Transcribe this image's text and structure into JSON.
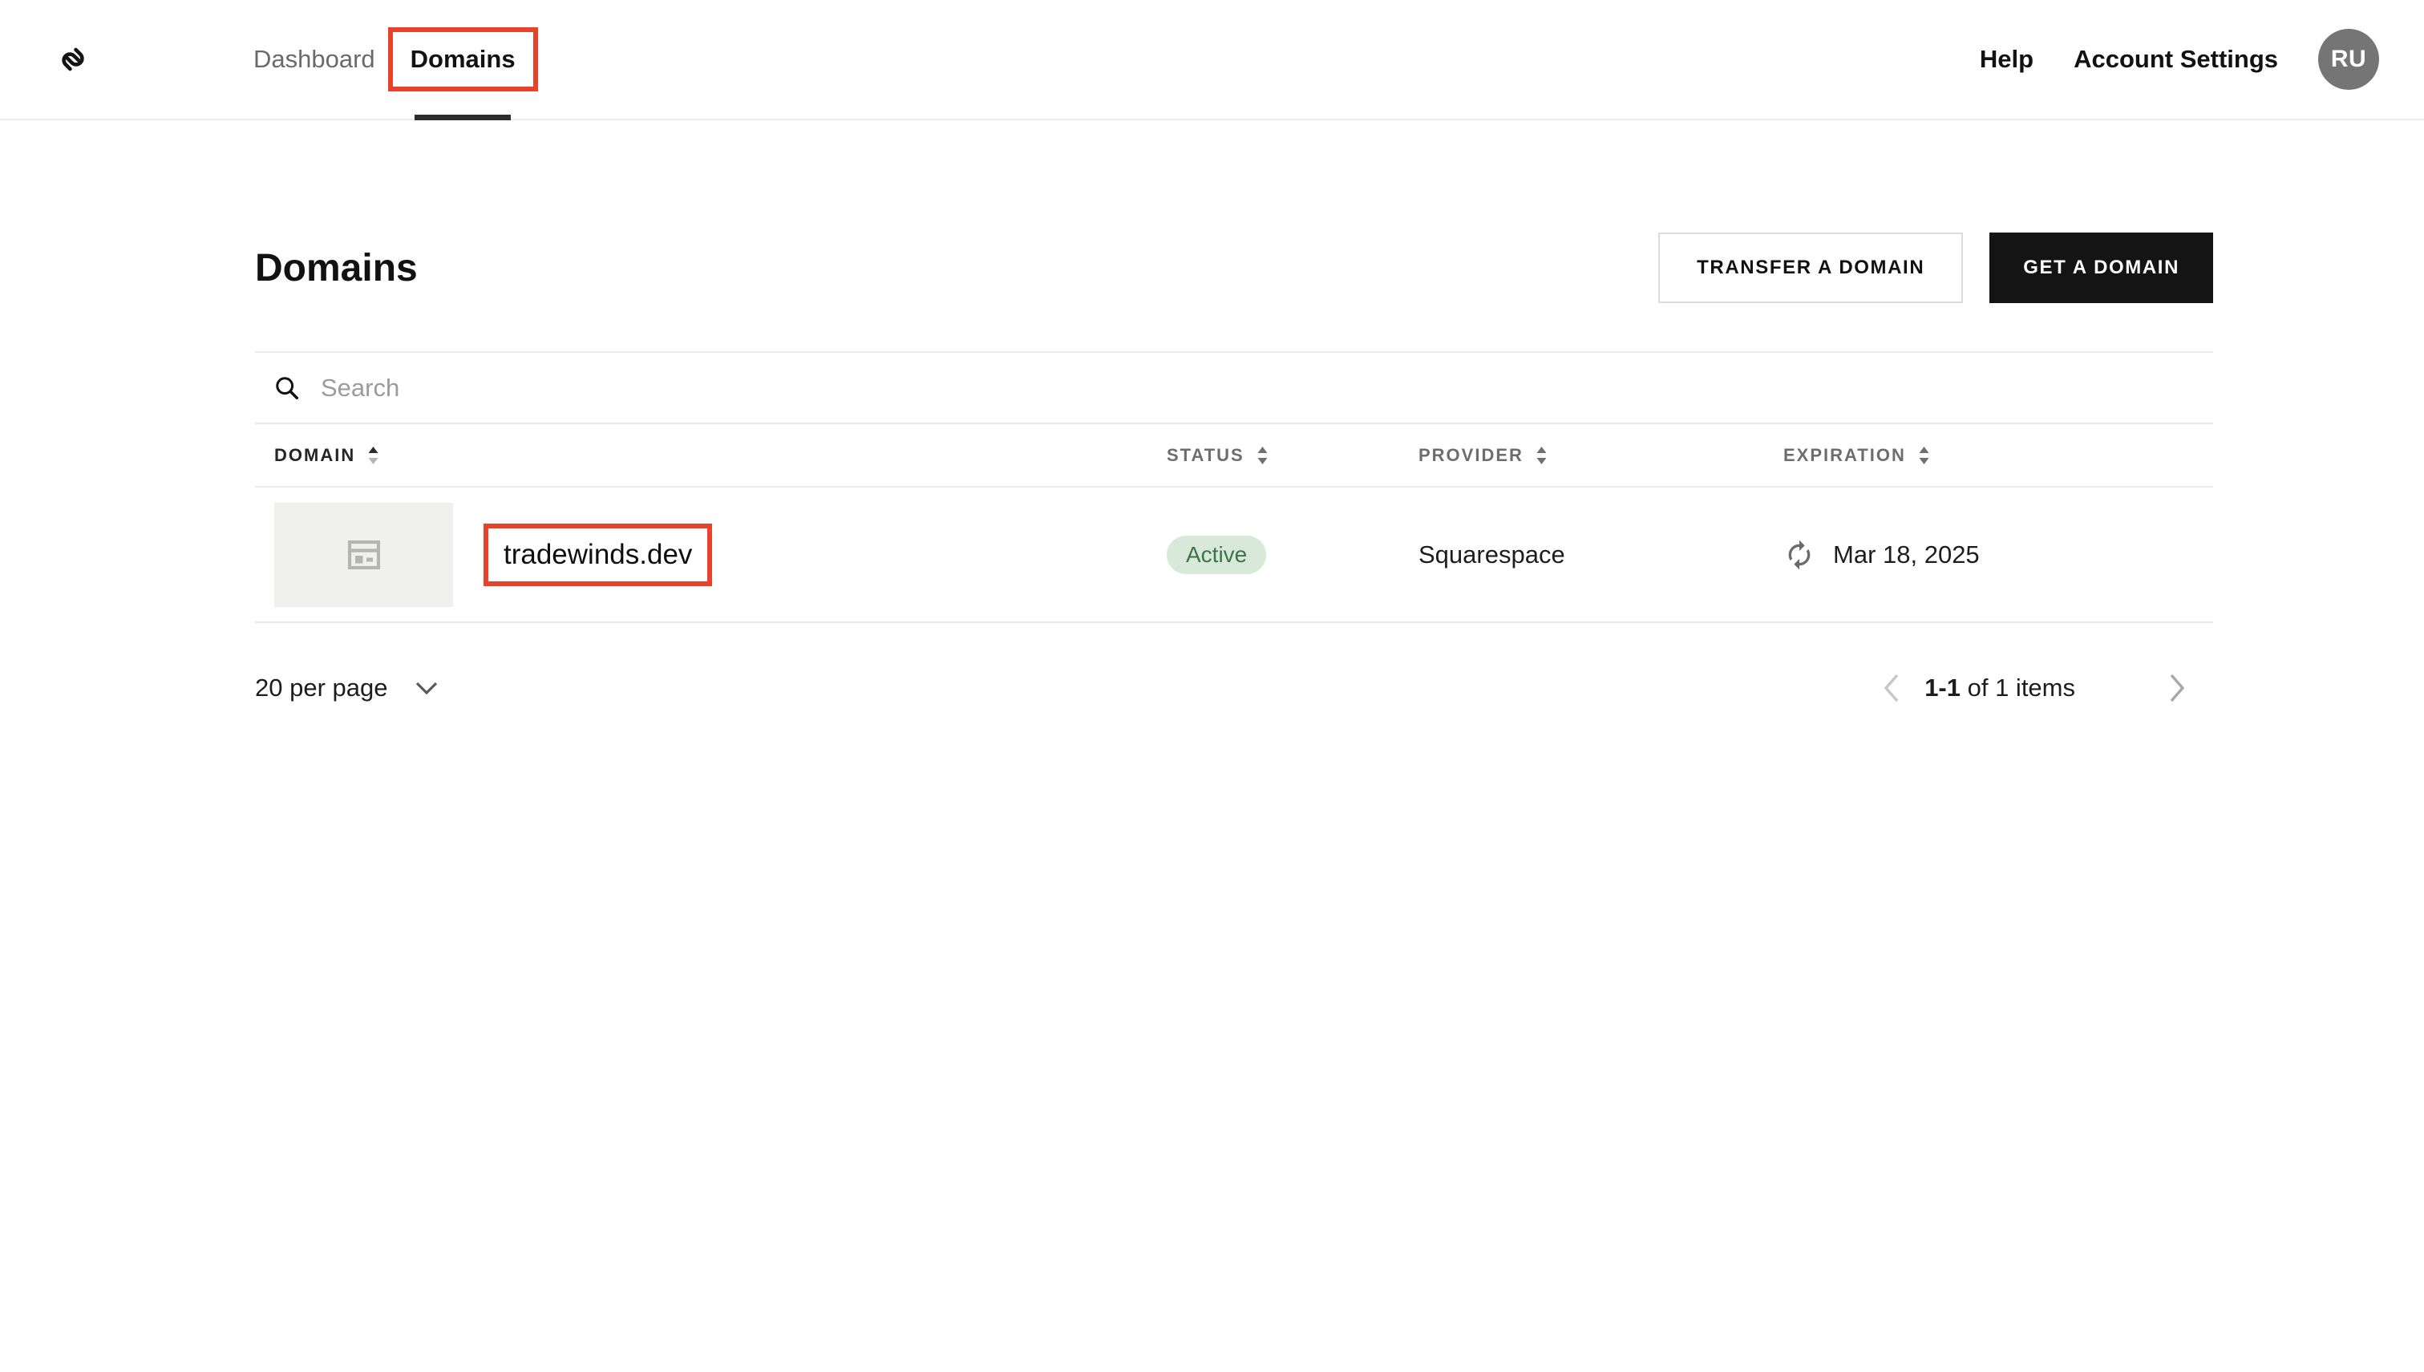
{
  "header": {
    "nav": {
      "dashboard": "Dashboard",
      "domains": "Domains"
    },
    "help": "Help",
    "account_settings": "Account Settings",
    "avatar_initials": "RU"
  },
  "page": {
    "title": "Domains",
    "transfer_button_label": "TRANSFER A DOMAIN",
    "get_button_label": "GET A DOMAIN"
  },
  "search": {
    "placeholder": "Search"
  },
  "table": {
    "columns": {
      "domain": "DOMAIN",
      "status": "STATUS",
      "provider": "PROVIDER",
      "expiration": "EXPIRATION"
    },
    "rows": [
      {
        "domain": "tradewinds.dev",
        "status": "Active",
        "provider": "Squarespace",
        "expiration": "Mar 18, 2025"
      }
    ]
  },
  "pagination": {
    "per_page": "20 per page",
    "range": "1-1",
    "range_suffix": " of 1 items"
  },
  "colors": {
    "annotation_red": "#e8432a",
    "badge_bg": "#d9e9d9",
    "badge_text": "#3a7447",
    "dark_button_bg": "#141414",
    "active_tab_underline": "#2d2d2d",
    "avatar_bg": "#757575",
    "thumb_bg": "#f0f0ef"
  }
}
